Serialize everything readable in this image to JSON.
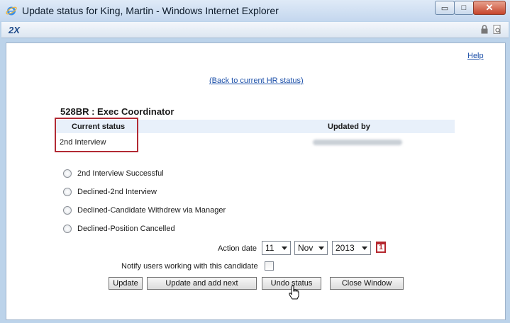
{
  "window": {
    "title": "Update status for King, Martin - Windows Internet Explorer",
    "minimize_glyph": "▭",
    "maximize_glyph": "□",
    "close_glyph": "✕"
  },
  "addressbar": {
    "logo": "2X"
  },
  "page": {
    "help_link": "Help",
    "back_link": "(Back to current HR status)",
    "job_title": "528BR :  Exec Coordinator",
    "table": {
      "col_status": "Current status",
      "col_updated": "Updated by",
      "status_value": "2nd Interview"
    },
    "options": [
      "2nd Interview Successful",
      "Declined-2nd Interview",
      "Declined-Candidate Withdrew via Manager",
      "Declined-Position Cancelled"
    ],
    "action_date": {
      "label": "Action date",
      "day": "11",
      "month": "Nov",
      "year": "2013",
      "calendar_badge": "1"
    },
    "notify_label": "Notify users working with this candidate",
    "buttons": {
      "update": "Update",
      "update_next": "Update and add next",
      "undo": "Undo status",
      "close": "Close Window"
    }
  }
}
